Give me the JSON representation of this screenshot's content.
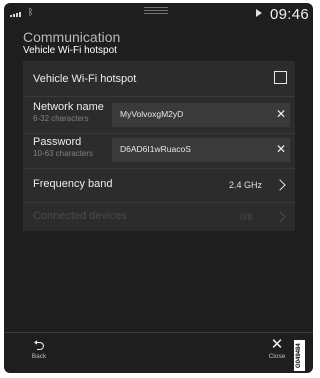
{
  "status_bar": {
    "time": "09:46",
    "bluetooth_icon": "bluetooth-icon",
    "signal_icon": "cellular-signal-icon",
    "media_icon": "play-icon"
  },
  "header": {
    "title": "Communication",
    "subtitle": "Vehicle Wi-Fi hotspot"
  },
  "settings": {
    "hotspot": {
      "label": "Vehicle Wi-Fi hotspot",
      "checked": false
    },
    "network_name": {
      "label": "Network name",
      "hint": "6-32 characters",
      "value": "MyVolvoxgM2yD",
      "clear_icon": "clear-x-icon"
    },
    "password": {
      "label": "Password",
      "hint": "10-63 characters",
      "value": "D6AD6I1wRuacoS",
      "clear_icon": "clear-x-icon"
    },
    "frequency_band": {
      "label": "Frequency band",
      "value": "2.4 GHz"
    },
    "connected_devices": {
      "label": "Connected devices",
      "value": "0/8",
      "enabled": false
    }
  },
  "bottom_bar": {
    "back_label": "Back",
    "close_label": "Close"
  },
  "image_code": "G049484"
}
